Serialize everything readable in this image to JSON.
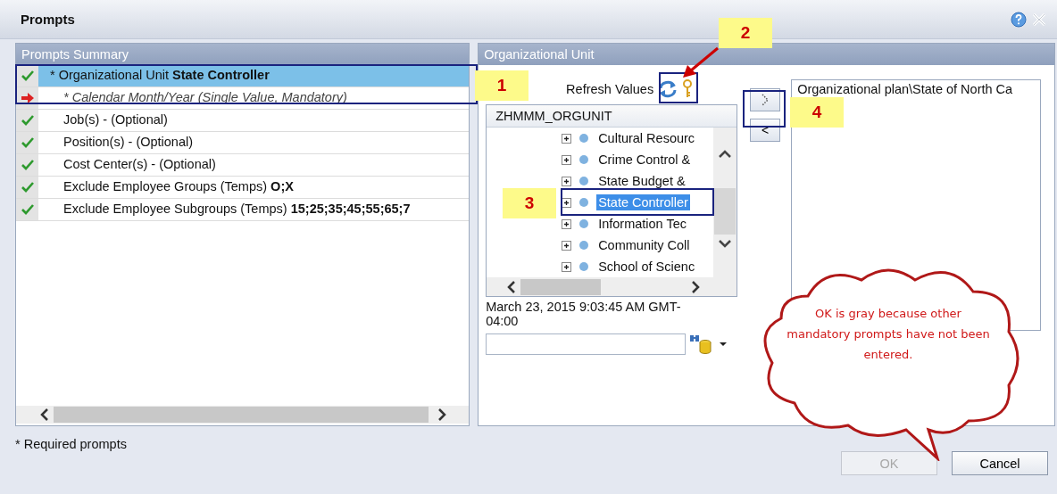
{
  "window": {
    "title": "Prompts"
  },
  "prompts_summary": {
    "header": "Prompts Summary",
    "items": [
      {
        "kind": "check",
        "label": "* Organizational Unit",
        "value": "State Controller",
        "selected": true
      },
      {
        "kind": "arrow",
        "label": "* Calendar Month/Year (Single Value, Mandatory)",
        "selected": false
      },
      {
        "kind": "check",
        "label": "Job(s) - (Optional)",
        "selected": false
      },
      {
        "kind": "check",
        "label": "Position(s) - (Optional)",
        "selected": false
      },
      {
        "kind": "check",
        "label": "Cost Center(s) - (Optional)",
        "selected": false
      },
      {
        "kind": "check",
        "label": "Exclude Employee Groups (Temps)",
        "value": "O;X",
        "selected": false
      },
      {
        "kind": "check",
        "label": "Exclude Employee Subgroups (Temps)",
        "value": "15;25;35;45;55;65;7",
        "selected": false
      }
    ]
  },
  "org_unit": {
    "header": "Organizational Unit",
    "refresh_label": "Refresh Values",
    "tree_header": "ZHMMM_ORGUNIT",
    "tree_items": [
      {
        "label": "Cultural Resourc",
        "selected": false
      },
      {
        "label": "Crime Control &",
        "selected": false
      },
      {
        "label": "State Budget &",
        "selected": false
      },
      {
        "label": "State Controller",
        "selected": true
      },
      {
        "label": "Information Tec",
        "selected": false
      },
      {
        "label": "Community Coll",
        "selected": false
      },
      {
        "label": "School of Scienc",
        "selected": false
      }
    ],
    "timestamp": "March 23, 2015 9:03:45 AM GMT-04:00",
    "remove_button": "<",
    "selected_values": [
      "Organizational plan\\State of North Ca"
    ]
  },
  "annotations": {
    "callouts": [
      {
        "number": "1"
      },
      {
        "number": "2"
      },
      {
        "number": "3"
      },
      {
        "number": "4"
      }
    ],
    "note": "OK is gray because other mandatory prompts have not been entered."
  },
  "footer": {
    "note": "* Required prompts",
    "buttons": [
      {
        "label": "OK",
        "disabled": true
      },
      {
        "label": "Cancel",
        "disabled": false
      }
    ]
  }
}
